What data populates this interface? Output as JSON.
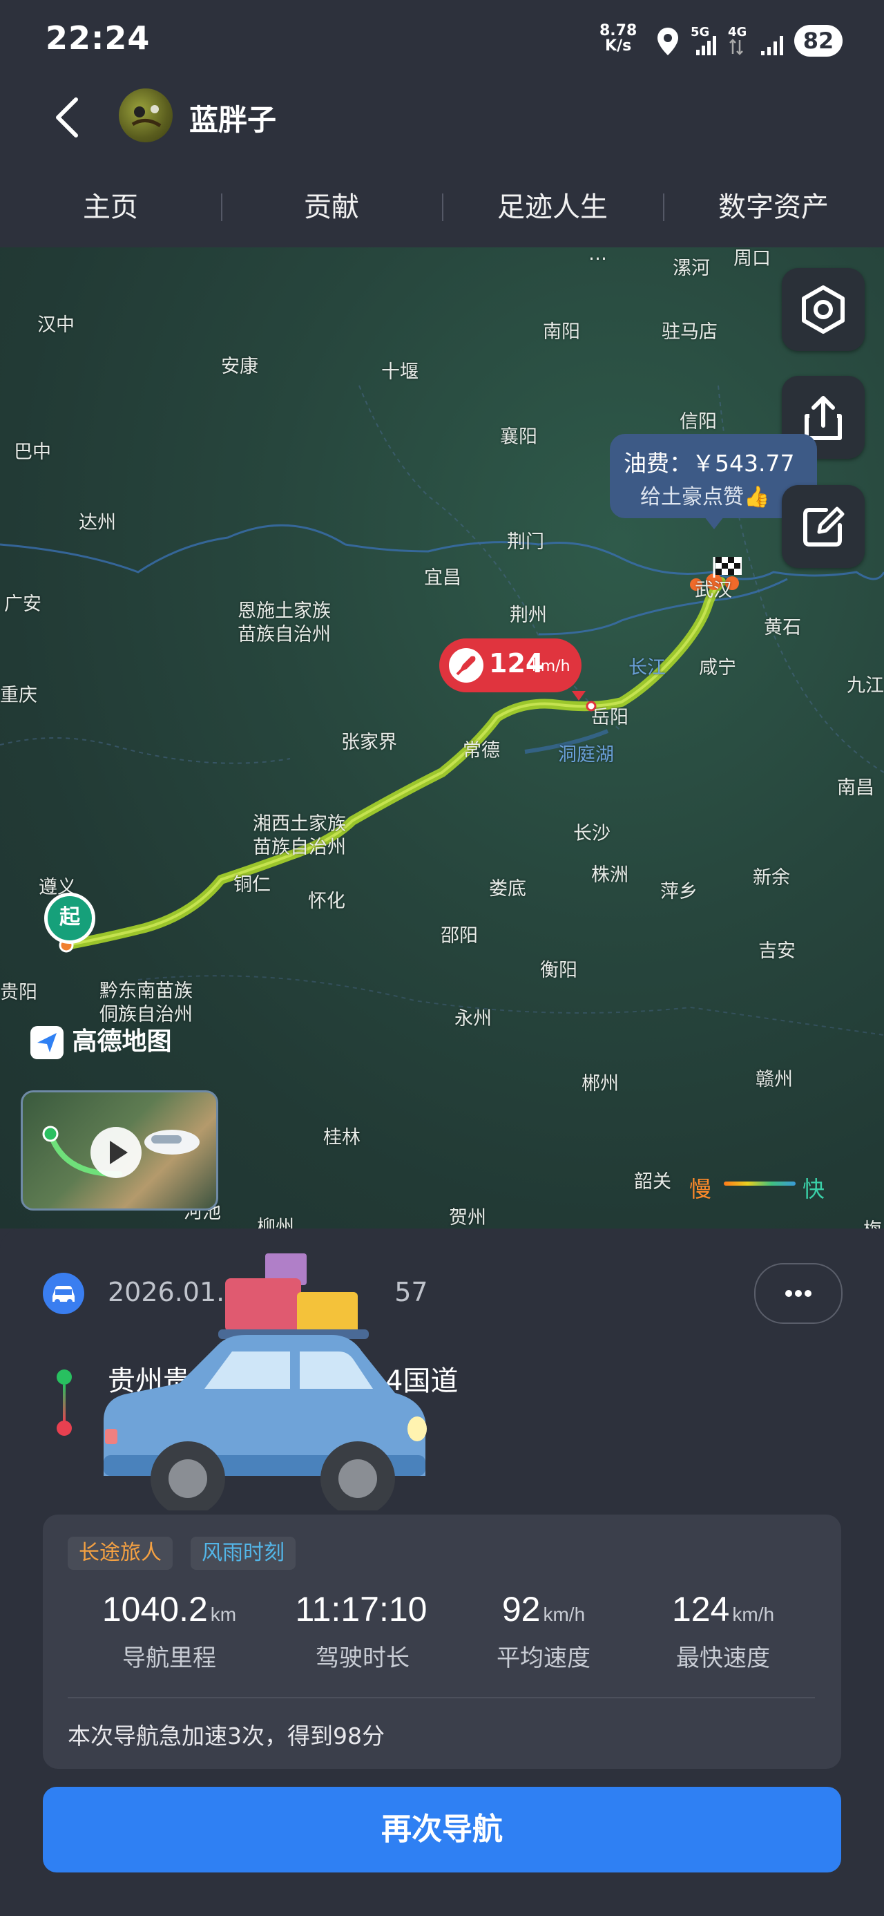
{
  "status_bar": {
    "time": "22:24",
    "net_speed_value": "8.78",
    "net_speed_unit": "K/s",
    "sim1": "5G",
    "sim2": "4G",
    "battery": "82"
  },
  "header": {
    "username": "蓝胖子"
  },
  "tabs": [
    {
      "label": "主页"
    },
    {
      "label": "贡献"
    },
    {
      "label": "足迹人生"
    },
    {
      "label": "数字资产"
    }
  ],
  "map": {
    "cities": [
      {
        "name": "漯河"
      },
      {
        "name": "周口"
      },
      {
        "name": "汉中"
      },
      {
        "name": "南阳"
      },
      {
        "name": "驻马店"
      },
      {
        "name": "安康"
      },
      {
        "name": "十堰"
      },
      {
        "name": "巴中"
      },
      {
        "name": "襄阳"
      },
      {
        "name": "信阳"
      },
      {
        "name": "达州"
      },
      {
        "name": "荆门"
      },
      {
        "name": "广安"
      },
      {
        "name": "宜昌"
      },
      {
        "name": "恩施土家族"
      },
      {
        "name": "苗族自治州"
      },
      {
        "name": "荆州"
      },
      {
        "name": "武汉"
      },
      {
        "name": "黄石"
      },
      {
        "name": "长江"
      },
      {
        "name": "咸宁"
      },
      {
        "name": "九江"
      },
      {
        "name": "重庆"
      },
      {
        "name": "岳阳"
      },
      {
        "name": "张家界"
      },
      {
        "name": "常德"
      },
      {
        "name": "洞庭湖"
      },
      {
        "name": "南昌"
      },
      {
        "name": "湘西土家族"
      },
      {
        "name": "苗族自治州"
      },
      {
        "name": "长沙"
      },
      {
        "name": "遵义"
      },
      {
        "name": "铜仁"
      },
      {
        "name": "株洲"
      },
      {
        "name": "新余"
      },
      {
        "name": "怀化"
      },
      {
        "name": "娄底"
      },
      {
        "name": "萍乡"
      },
      {
        "name": "邵阳"
      },
      {
        "name": "吉安"
      },
      {
        "name": "贵阳"
      },
      {
        "name": "黔东南苗族"
      },
      {
        "name": "侗族自治州"
      },
      {
        "name": "衡阳"
      },
      {
        "name": "永州"
      },
      {
        "name": "赣州"
      },
      {
        "name": "郴州"
      },
      {
        "name": "桂林"
      },
      {
        "name": "韶关"
      },
      {
        "name": "河池"
      },
      {
        "name": "柳州"
      },
      {
        "name": "贺州"
      },
      {
        "name": "梅"
      }
    ],
    "fuel_cost": "油费：￥543.77",
    "fuel_like": "给土豪点赞👍",
    "max_speed_value": "124",
    "max_speed_unit": "km/h",
    "start_label": "起",
    "logo": "高德地图",
    "legend_slow": "慢",
    "legend_fast": "快"
  },
  "trip": {
    "datetime": "2026.01.",
    "datetime_suffix": "57",
    "from": "贵州贵",
    "from_suffix": "4国道",
    "tags": [
      "长途旅人",
      "风雨时刻"
    ],
    "stats": [
      {
        "value": "1040.2",
        "unit": "km",
        "label": "导航里程"
      },
      {
        "value": "11:17:10",
        "unit": "",
        "label": "驾驶时长"
      },
      {
        "value": "92",
        "unit": "km/h",
        "label": "平均速度"
      },
      {
        "value": "124",
        "unit": "km/h",
        "label": "最快速度"
      }
    ],
    "summary": "本次导航急加速3次，得到98分",
    "renav_label": "再次导航"
  },
  "colors": {
    "accent": "#2f80f3",
    "route": "#b8e02a",
    "speed_badge": "#e0343e"
  }
}
